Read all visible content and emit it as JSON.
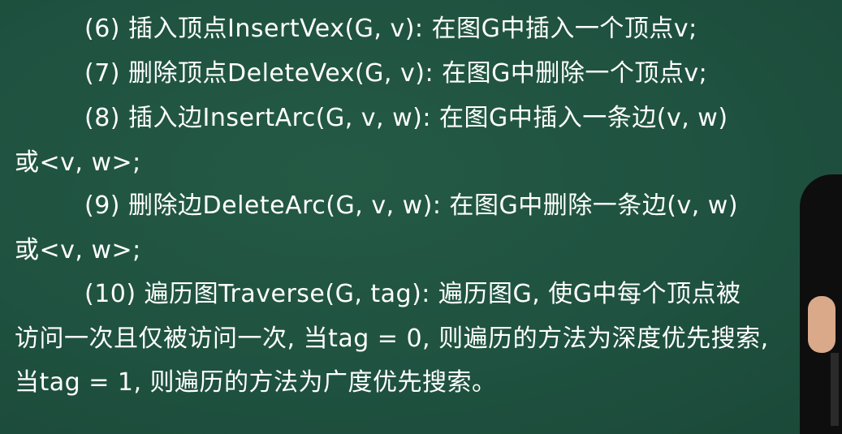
{
  "lines": [
    "(6) 插入顶点InsertVex(G, v): 在图G中插入一个顶点v;",
    "(7) 删除顶点DeleteVex(G, v): 在图G中删除一个顶点v;",
    "(8) 插入边InsertArc(G, v, w): 在图G中插入一条边(v, w)",
    "或<v, w>;",
    "(9) 删除边DeleteArc(G, v, w): 在图G中删除一条边(v, w)",
    "或<v, w>;",
    "(10) 遍历图Traverse(G, tag): 遍历图G, 使G中每个顶点被",
    "访问一次且仅被访问一次, 当tag = 0, 则遍历的方法为深度优先搜索,",
    "当tag = 1, 则遍历的方法为广度优先搜索。"
  ],
  "colors": {
    "board": "#1f5240",
    "text": "#ffffff"
  }
}
